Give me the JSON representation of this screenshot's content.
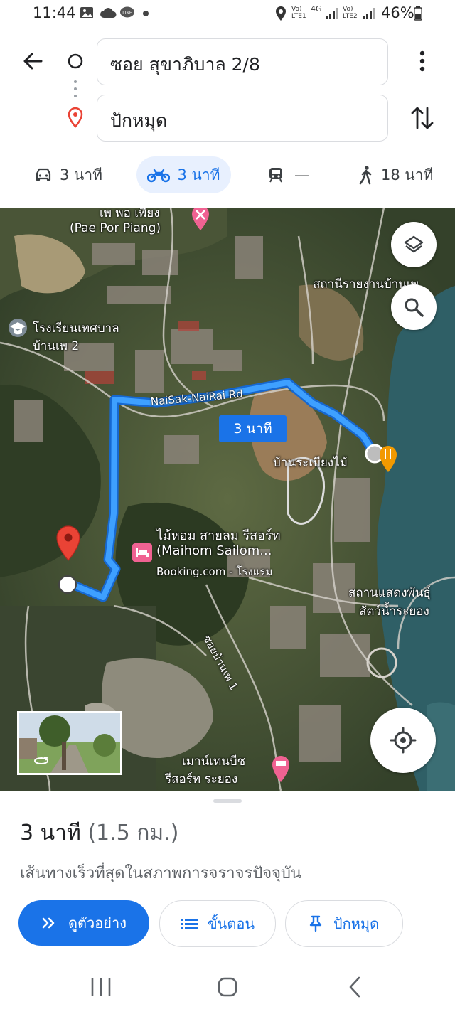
{
  "status_bar": {
    "time": "11:44",
    "lte1": "Vo)\nLTE1",
    "net": "4G",
    "lte2": "Vo)\nLTE2",
    "battery": "46%"
  },
  "directions": {
    "origin": "ซอย สุขาภิบาล 2/8",
    "destination": "ปักหมุด"
  },
  "modes": [
    {
      "name": "car",
      "label": "3 นาที"
    },
    {
      "name": "motorcycle",
      "label": "3 นาที"
    },
    {
      "name": "transit",
      "label": "—"
    },
    {
      "name": "walk",
      "label": "18 นาที"
    }
  ],
  "map": {
    "labels": {
      "cafe_name_th": "เพ พอ เพียง",
      "cafe_name_en": "(Pae Por Piang)",
      "station": "สถานีรายงานบ้านเพ",
      "school_line1": "โรงเรียนเทศบาล",
      "school_line2": "บ้านเพ 2",
      "road": "NaiSak-NaiRai Rd",
      "restaurant": "บ้านระเบียงไม้",
      "resort_line1": "ไม้หอม สายลม รีสอร์ท",
      "resort_line2": "(Maihom Sailom...",
      "resort_line3": "Booking.com - โรงแรม",
      "aquarium_line1": "สถานแสดงพันธุ์",
      "aquarium_line2": "สัตว์น้ำระยอง",
      "soi": "ซอยบ้านเพ 1",
      "mountain_line1": "เมาน์เทนบีช",
      "mountain_line2": "รีสอร์ท ระยอง"
    },
    "route_badge": "3 นาที"
  },
  "sheet": {
    "summary_time": "3 นาที",
    "summary_distance": "(1.5 กม.)",
    "subtitle": "เส้นทางเร็วที่สุดในสภาพการจราจรปัจจุบัน",
    "preview_button": "ดูตัวอย่าง",
    "steps_button": "ขั้นตอน",
    "pin_button": "ปักหมุด"
  },
  "colors": {
    "accent": "#1a73e8",
    "route": "#2b8ff0",
    "pin": "#ea4335"
  }
}
